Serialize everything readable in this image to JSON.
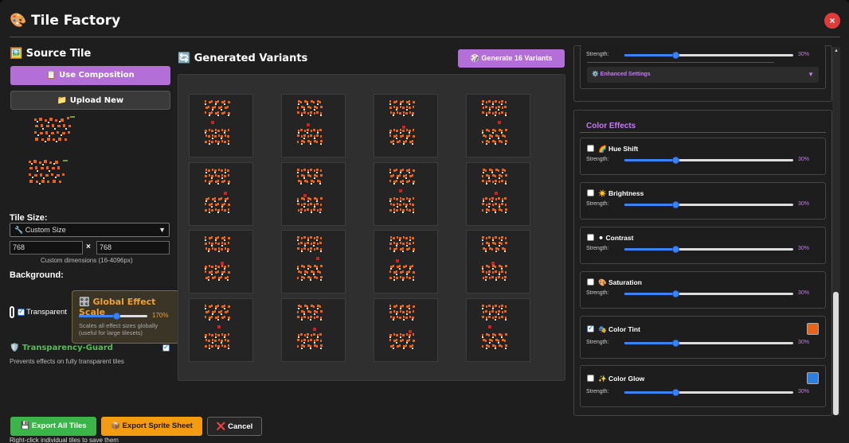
{
  "window": {
    "title": "🎨 Tile Factory",
    "close_label": "×"
  },
  "source": {
    "heading": "🖼️ Source Tile",
    "use_composition_label": "📋 Use Composition",
    "upload_new_label": "📁 Upload New"
  },
  "tile_size": {
    "label": "Tile Size:",
    "select_value": "🔧 Custom Size",
    "width_value": "768",
    "times": "×",
    "height_value": "768",
    "hint": "Custom dimensions (16-4096px)"
  },
  "background": {
    "label": "Background:",
    "transparent_label": "Transparent"
  },
  "global_effect": {
    "title": "🎛️ Global Effect Scale",
    "value_text": "170%",
    "value": 170,
    "description": "Scales all effect sizes globally (useful for large tilesets)"
  },
  "guard": {
    "label": "🛡️ Transparency-Guard",
    "description": "Prevents effects on fully transparent tiles"
  },
  "variants": {
    "heading": "🔄 Generated Variants",
    "generate_label": "🎲 Generate 16 Variants",
    "count": 16
  },
  "top_partial": {
    "strength_label": "Strength:",
    "strength_text": "30%",
    "strength_value": 30,
    "enhanced_label": "⚙️ Enhanced Settings",
    "enhanced_caret": "▼"
  },
  "color_effects": {
    "title": "Color Effects",
    "items": [
      {
        "name": "🌈 Hue Shift",
        "checked": false,
        "strength_label": "Strength:",
        "strength_text": "30%",
        "strength": 30
      },
      {
        "name": "☀️ Brightness",
        "checked": false,
        "strength_label": "Strength:",
        "strength_text": "30%",
        "strength": 30
      },
      {
        "name": "⚫ Contrast",
        "checked": false,
        "strength_label": "Strength:",
        "strength_text": "30%",
        "strength": 30
      },
      {
        "name": "🎨 Saturation",
        "checked": false,
        "strength_label": "Strength:",
        "strength_text": "30%",
        "strength": 30
      },
      {
        "name": "🎭 Color Tint",
        "checked": true,
        "strength_label": "Strength:",
        "strength_text": "30%",
        "strength": 30,
        "swatch": "#e8641a"
      },
      {
        "name": "✨ Color Glow",
        "checked": false,
        "strength_label": "Strength:",
        "strength_text": "30%",
        "strength": 30,
        "swatch": "#2a7fe0"
      }
    ]
  },
  "footer": {
    "export_all_label": "💾 Export All Tiles",
    "export_sheet_label": "📦 Export Sprite Sheet",
    "cancel_label": "❌ Cancel",
    "hint": "Right-click individual tiles to save them"
  },
  "colors": {
    "accent_purple": "#b46ed8",
    "export_green": "#3bb54a",
    "export_orange": "#f39c12",
    "cancel_red": "#c0392b",
    "tile_orange": "#e8641a"
  }
}
